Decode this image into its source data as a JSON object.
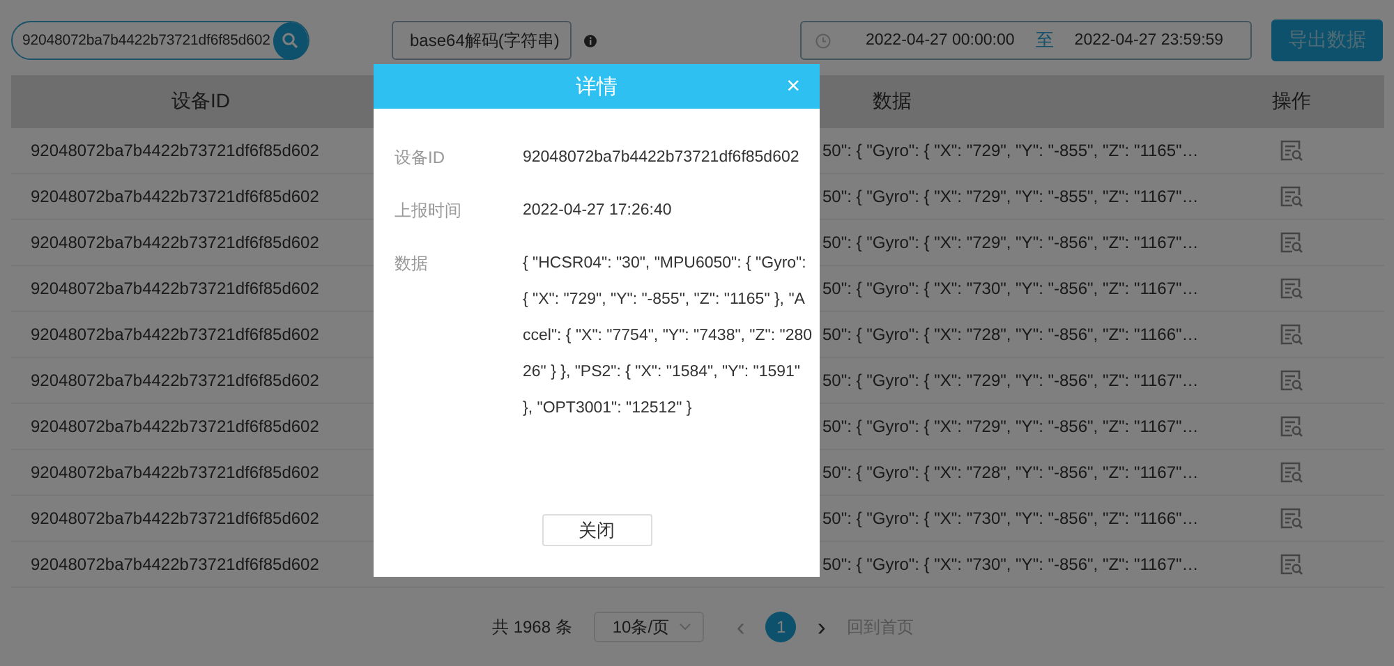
{
  "search": {
    "value": "92048072ba7b4422b73721df6f85d602"
  },
  "decode_select": {
    "value": "base64解码(字符串)"
  },
  "date_range": {
    "start": "2022-04-27 00:00:00",
    "separator": "至",
    "end": "2022-04-27 23:59:59"
  },
  "export_button": "导出数据",
  "table": {
    "columns": [
      "设备ID",
      "数据",
      "操作"
    ],
    "rows": [
      {
        "device_id": "92048072ba7b4422b73721df6f85d602",
        "data": "50\": { \"Gyro\": { \"X\": \"729\", \"Y\": \"-855\", \"Z\": \"1165\"…"
      },
      {
        "device_id": "92048072ba7b4422b73721df6f85d602",
        "data": "50\": { \"Gyro\": { \"X\": \"729\", \"Y\": \"-855\", \"Z\": \"1167\"…"
      },
      {
        "device_id": "92048072ba7b4422b73721df6f85d602",
        "data": "50\": { \"Gyro\": { \"X\": \"729\", \"Y\": \"-856\", \"Z\": \"1167\"…"
      },
      {
        "device_id": "92048072ba7b4422b73721df6f85d602",
        "data": "50\": { \"Gyro\": { \"X\": \"730\", \"Y\": \"-856\", \"Z\": \"1167\"…"
      },
      {
        "device_id": "92048072ba7b4422b73721df6f85d602",
        "data": "50\": { \"Gyro\": { \"X\": \"728\", \"Y\": \"-856\", \"Z\": \"1166\"…"
      },
      {
        "device_id": "92048072ba7b4422b73721df6f85d602",
        "data": "50\": { \"Gyro\": { \"X\": \"729\", \"Y\": \"-856\", \"Z\": \"1167\"…"
      },
      {
        "device_id": "92048072ba7b4422b73721df6f85d602",
        "data": "50\": { \"Gyro\": { \"X\": \"729\", \"Y\": \"-856\", \"Z\": \"1167\"…"
      },
      {
        "device_id": "92048072ba7b4422b73721df6f85d602",
        "data": "50\": { \"Gyro\": { \"X\": \"728\", \"Y\": \"-856\", \"Z\": \"1167\"…"
      },
      {
        "device_id": "92048072ba7b4422b73721df6f85d602",
        "data": "50\": { \"Gyro\": { \"X\": \"730\", \"Y\": \"-856\", \"Z\": \"1166\"…"
      },
      {
        "device_id": "92048072ba7b4422b73721df6f85d602",
        "data": "50\": { \"Gyro\": { \"X\": \"730\", \"Y\": \"-856\", \"Z\": \"1167\"…"
      }
    ]
  },
  "pagination": {
    "total": "共 1968 条",
    "page_size": "10条/页",
    "prev": "‹",
    "pages": [
      {
        "label": "1",
        "selected": true
      }
    ],
    "next": "›",
    "home": "回到首页"
  },
  "dialog": {
    "title": "详情",
    "close_symbol": "×",
    "fields": [
      {
        "label": "设备ID",
        "value": "92048072ba7b4422b73721df6f85d602"
      },
      {
        "label": "上报时间",
        "value": "2022-04-27 17:26:40"
      },
      {
        "label": "数据",
        "value": "{ \"HCSR04\": \"30\", \"MPU6050\": { \"Gyro\": { \"X\": \"729\", \"Y\": \"-855\", \"Z\": \"1165\" }, \"Accel\": { \"X\": \"7754\", \"Y\": \"7438\", \"Z\": \"28026\" } }, \"PS2\": { \"X\": \"1584\", \"Y\": \"1591\" }, \"OPT3001\": \"12512\" }"
      }
    ],
    "close_button": "关闭"
  }
}
